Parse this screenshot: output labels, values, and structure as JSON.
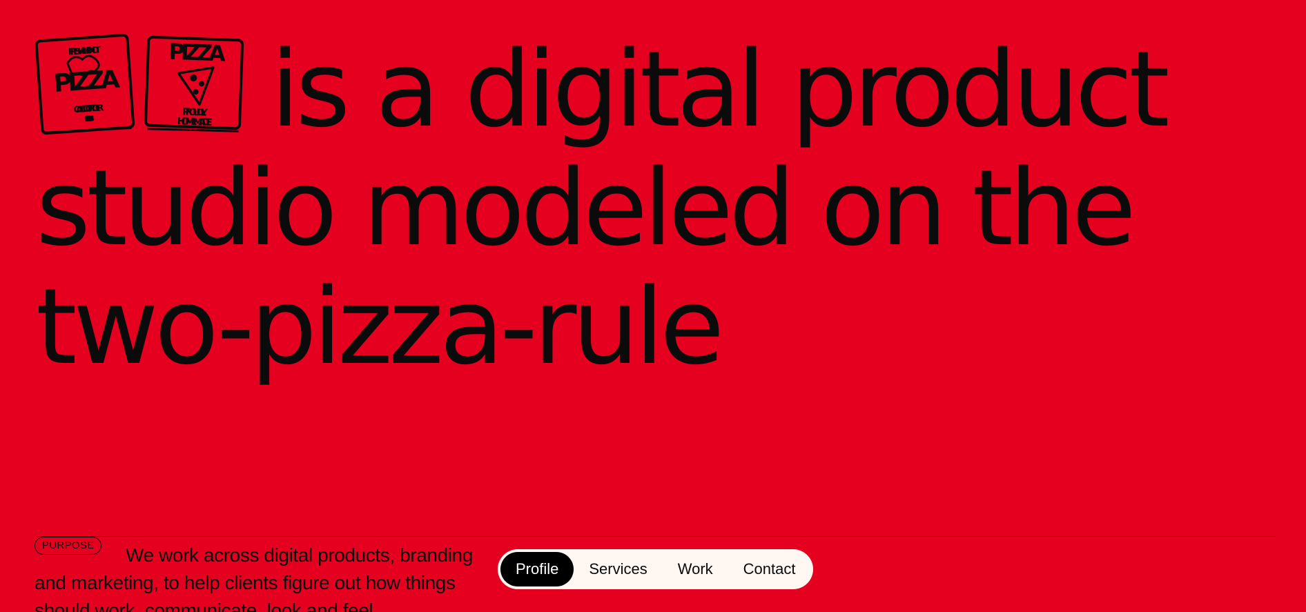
{
  "hero": {
    "line1": "is a digital product",
    "line2": "studio modeled on the",
    "line3": "two-pizza-rule"
  },
  "logo_boxes": [
    {
      "name": "pizza-box-fresh-and-hot",
      "top": "FRESH AND HOT",
      "main": "PIZZA",
      "bottom": "CALL TO ORDER",
      "phone": "030 948 008 84"
    },
    {
      "name": "pizza-box-proudly-homemade",
      "main": "PIZZA",
      "bottom1": "PROUDLY",
      "bottom2": "HOMEMADE"
    }
  ],
  "purpose": {
    "tag": "PURPOSE",
    "text": "We work across digital products, branding and marketing, to help clients figure out how things should work, communicate, look and feel."
  },
  "nav": {
    "items": [
      "Profile",
      "Services",
      "Work",
      "Contact"
    ],
    "active": "Profile"
  },
  "colors": {
    "background": "#e6001f",
    "text": "#0b0b0b",
    "nav_bg": "#fff7f2",
    "nav_active_bg": "#000000"
  }
}
